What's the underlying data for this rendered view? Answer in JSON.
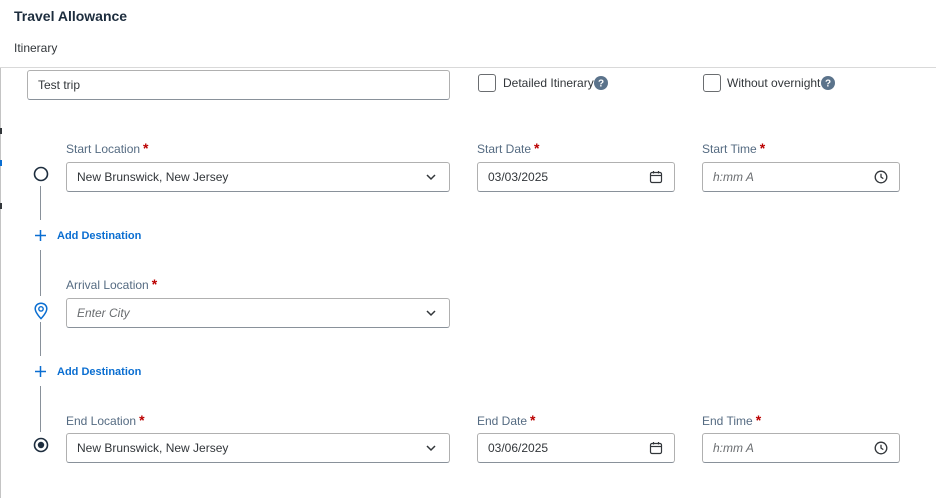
{
  "header": {
    "title": "Travel Allowance",
    "subtitle": "Itinerary"
  },
  "trip_name": {
    "value": "Test trip"
  },
  "options": {
    "detailed_itinerary": {
      "label": "Detailed Itinerary",
      "checked": false
    },
    "without_overnight": {
      "label": "Without overnight",
      "checked": false
    }
  },
  "start": {
    "location_label": "Start Location",
    "location_value": "New Brunswick, New Jersey",
    "date_label": "Start Date",
    "date_value": "03/03/2025",
    "time_label": "Start Time",
    "time_placeholder": "h:mm A"
  },
  "add_destination_label": "Add Destination",
  "arrival": {
    "location_label": "Arrival Location",
    "location_placeholder": "Enter City"
  },
  "end": {
    "location_label": "End Location",
    "location_value": "New Brunswick, New Jersey",
    "date_label": "End Date",
    "date_value": "03/06/2025",
    "time_label": "End Time",
    "time_placeholder": "h:mm A"
  },
  "required_marker": "*",
  "colors": {
    "accent": "#0a6ed1",
    "required": "#bb0000",
    "label": "#556b82"
  }
}
